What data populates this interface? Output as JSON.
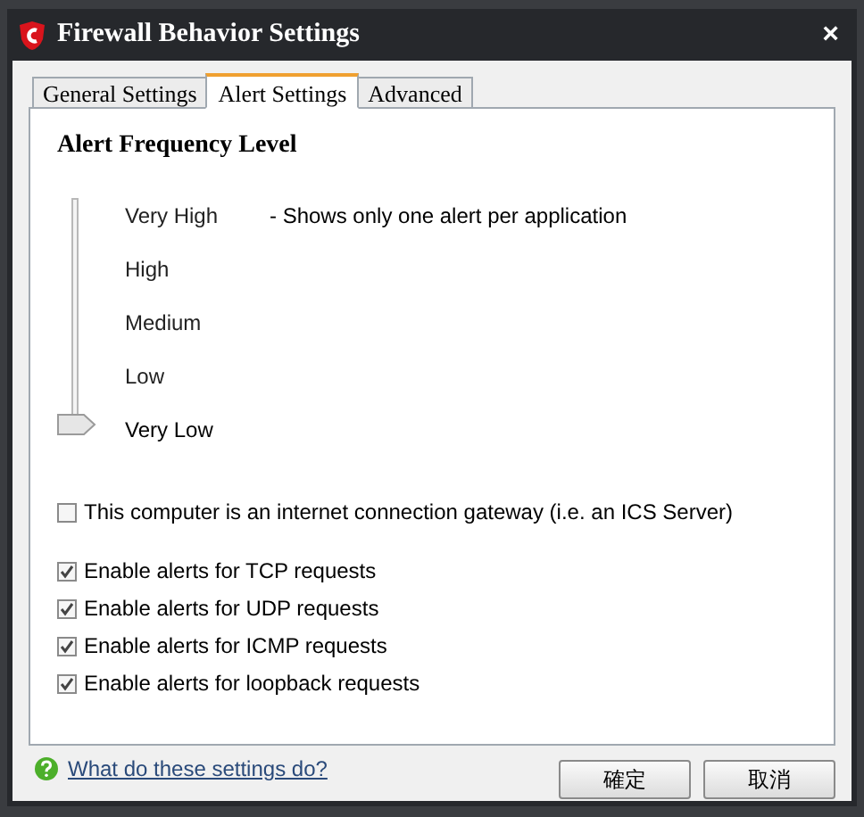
{
  "window": {
    "title": "Firewall Behavior Settings",
    "close": "×"
  },
  "tabs": [
    {
      "label": "General Settings",
      "selected": false
    },
    {
      "label": "Alert Settings",
      "selected": true
    },
    {
      "label": "Advanced",
      "selected": false
    }
  ],
  "alert_frequency": {
    "heading": "Alert Frequency Level",
    "levels": [
      {
        "label": "Very High",
        "note": "- Shows only one alert per application",
        "selected": false
      },
      {
        "label": "High",
        "selected": false
      },
      {
        "label": "Medium",
        "selected": false
      },
      {
        "label": "Low",
        "selected": false
      },
      {
        "label": "Very Low",
        "selected": true
      }
    ]
  },
  "gateway": {
    "label": "This computer is an internet connection gateway (i.e. an ICS Server)",
    "checked": false
  },
  "options": [
    {
      "label": "Enable alerts for TCP requests",
      "checked": true
    },
    {
      "label": "Enable alerts for UDP requests",
      "checked": true
    },
    {
      "label": "Enable alerts for ICMP requests",
      "checked": true
    },
    {
      "label": "Enable alerts for loopback requests",
      "checked": true
    }
  ],
  "help_link": "What do these settings do?",
  "buttons": [
    "確定",
    "取消"
  ]
}
